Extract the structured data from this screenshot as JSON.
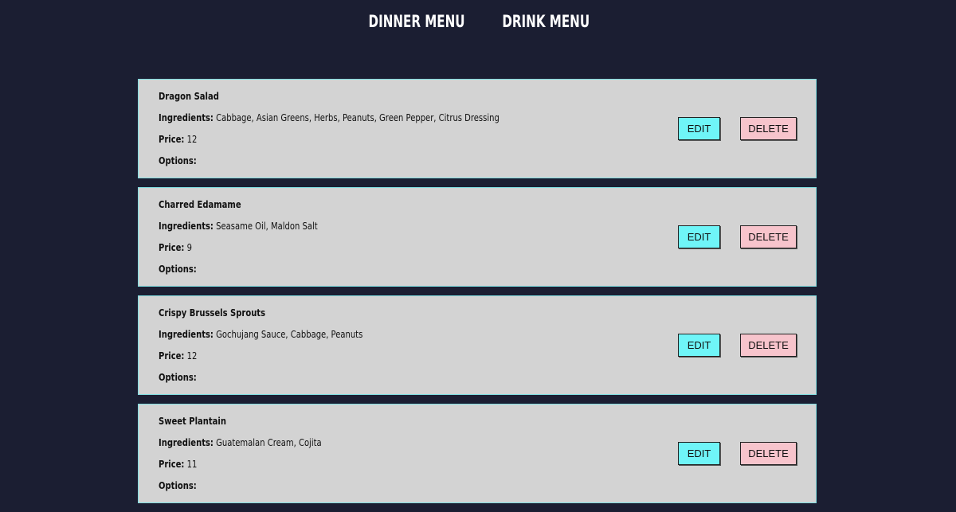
{
  "nav": {
    "links": [
      "DINNER MENU",
      "DRINK MENU"
    ]
  },
  "labels": {
    "ingredients": "Ingredients:",
    "price": "Price:",
    "options": "Options:",
    "edit": "EDIT",
    "delete": "DELETE"
  },
  "items": [
    {
      "name": "Dragon Salad",
      "ingredients": "Cabbage, Asian Greens, Herbs, Peanuts, Green Pepper, Citrus Dressing",
      "price": "12",
      "options": ""
    },
    {
      "name": "Charred Edamame",
      "ingredients": "Seasame Oil, Maldon Salt",
      "price": "9",
      "options": ""
    },
    {
      "name": "Crispy Brussels Sprouts",
      "ingredients": "Gochujang Sauce, Cabbage, Peanuts",
      "price": "12",
      "options": ""
    },
    {
      "name": "Sweet Plantain",
      "ingredients": "Guatemalan Cream, Cojita",
      "price": "11",
      "options": ""
    }
  ],
  "colors": {
    "background": "#1b1e32",
    "card": "#d3d3d3",
    "card_border": "#7fdde0",
    "edit_button": "#6ff5f8",
    "delete_button": "#f7c4cc"
  }
}
